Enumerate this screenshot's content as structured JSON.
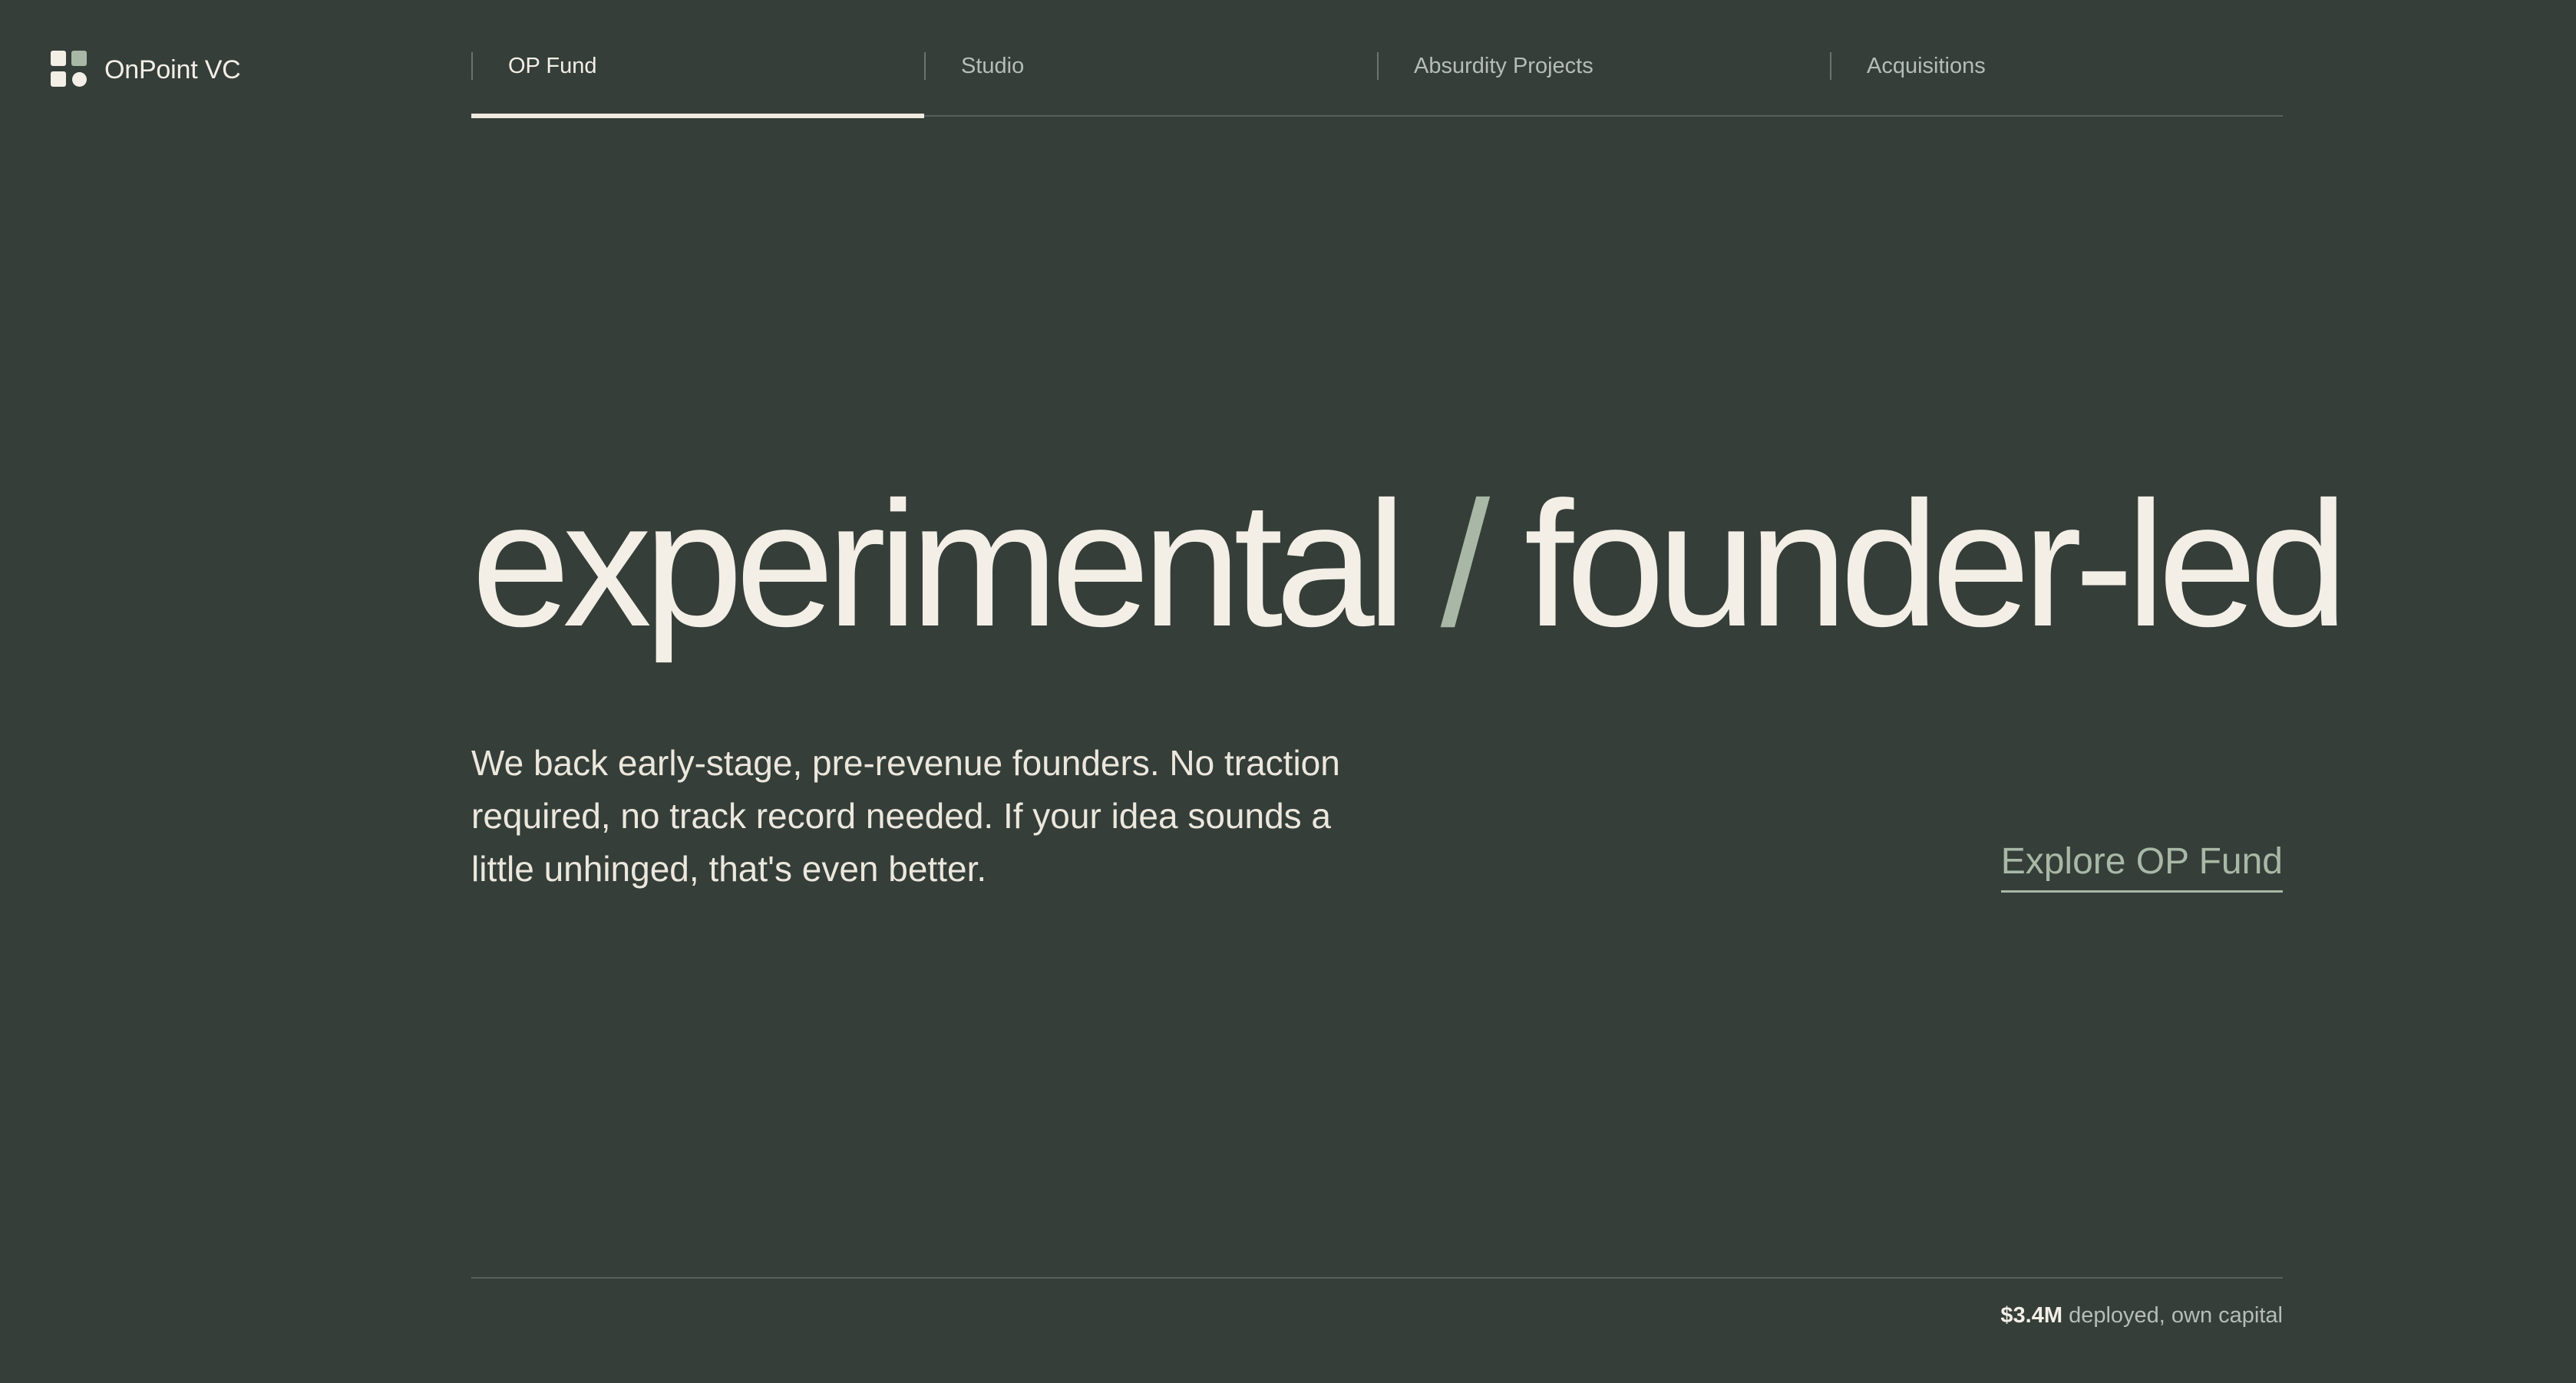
{
  "brand": {
    "name": "OnPoint VC",
    "logo_icon": "grid-logo-icon",
    "colors": {
      "background": "#353e39",
      "text": "#f3efe6",
      "accent": "#a9b8a6",
      "muted": "#b7bdb6"
    }
  },
  "nav": {
    "tabs": [
      {
        "label": "OP Fund",
        "active": true
      },
      {
        "label": "Studio",
        "active": false
      },
      {
        "label": "Absurdity Projects",
        "active": false
      },
      {
        "label": "Acquisitions",
        "active": false
      }
    ]
  },
  "hero": {
    "headline_left": "experimental",
    "headline_separator": "/",
    "headline_right": "founder-led",
    "body": "We back early-stage, pre-revenue founders. No traction required, no track record needed. If your idea sounds a little unhinged, that's even better.",
    "cta_label": "Explore OP Fund"
  },
  "footer": {
    "stat_amount": "$3.4M",
    "stat_text": "deployed, own capital"
  }
}
